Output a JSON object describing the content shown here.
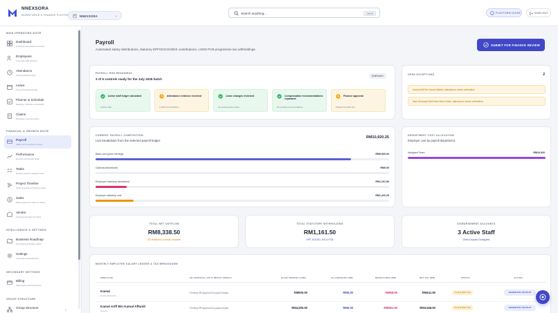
{
  "header": {
    "brand_name": "NNEXSORA",
    "brand_sub": "WORKFORCE & FINANCE PLATFORM",
    "org_label": "NNEXSORA",
    "search_placeholder": "Search anything...",
    "search_shortcut": "Ctrl+K",
    "guide_label": "PLATFORM GUIDE",
    "signout_label": "SIGN OUT"
  },
  "sidebar": {
    "sections": [
      {
        "title": "MAIN OPERATING SUITE"
      },
      {
        "title": "FINANCIAL & GROWTH SUITE"
      },
      {
        "title": "INTELLIGENCE & SETTINGS"
      },
      {
        "title": "SECONDARY SETTINGS"
      },
      {
        "title": "GROUP STRUCTURE"
      }
    ],
    "items": [
      {
        "label": "Dashboard",
        "sub": "Company performance overview",
        "icon": "grid-icon"
      },
      {
        "label": "Employees",
        "sub": "Corporate staff directory",
        "icon": "users-icon"
      },
      {
        "label": "Attendance",
        "sub": "Verified geofence logs",
        "icon": "clock-icon"
      },
      {
        "label": "Leave",
        "sub": "Time-off scheduling logs",
        "icon": "calendar-icon"
      },
      {
        "label": "Planner & Schedule",
        "sub": "Meetings, activities & checklists",
        "icon": "planner-icon"
      },
      {
        "label": "Claims",
        "sub": "Employee expense claims",
        "icon": "receipt-icon"
      },
      {
        "label": "Payroll",
        "sub": "Salary and compliance engine",
        "icon": "payroll-icon"
      },
      {
        "label": "Performance",
        "sub": "Reviews and growth goals",
        "icon": "chart-icon"
      },
      {
        "label": "Tasks",
        "sub": "Monitor issued & assigned work",
        "icon": "tasks-icon"
      },
      {
        "label": "Project Timeline",
        "sub": "Gantt progress and delivery plans",
        "icon": "timeline-icon"
      },
      {
        "label": "Sales",
        "sub": "Sales leads and customer values",
        "icon": "sales-icon"
      },
      {
        "label": "Vendor",
        "sub": "Invoicing and payment flows",
        "icon": "vendor-icon"
      },
      {
        "label": "Business Roadmap",
        "sub": "Forecasting & targets setting",
        "icon": "roadmap-icon"
      },
      {
        "label": "Settings",
        "sub": "Corporate threshold limits",
        "icon": "gear-icon"
      },
      {
        "label": "Billing",
        "sub": "Subscription pricing licenses",
        "icon": "billing-icon"
      },
      {
        "label": "Group Structure",
        "sub": "",
        "icon": "structure-icon"
      }
    ]
  },
  "hero": {
    "title": "Payroll",
    "subtitle": "Automated salary distributions, statutory EPF/SOCSO/EIS contributions, LHDN PCB progressive tax withholdings.",
    "submit_label": "SUBMIT FOR FINANCE REVIEW"
  },
  "readiness": {
    "label": "PAYROLL RUN READINESS",
    "headline": "3 of 5 controls ready for the July 2026 batch",
    "badge": "Draft batch",
    "controls": [
      {
        "title": "Active staff ledger calculated",
        "sub": "3 active staff",
        "state": "ok"
      },
      {
        "title": "Attendance evidence received",
        "sub": "2 staff need verification",
        "state": "warn"
      },
      {
        "title": "Leave changes reviewed",
        "sub": "No pending leave review",
        "state": "ok"
      },
      {
        "title": "Compensation recommendations separated",
        "sub": "No pending recommendations",
        "state": "ok"
      },
      {
        "title": "Finance approval",
        "sub": "Prepare the batch first",
        "state": "warn"
      }
    ]
  },
  "exceptions": {
    "label": "OPEN EXCEPTIONS",
    "count": "2",
    "items": [
      "Kamal Ariff Bin Kamal Affandi: attendance needs verification",
      "Wan Ghazaani Binti Wan Mohd Sabri: attendance needs verification"
    ]
  },
  "composition": {
    "label": "CURRENT PAYROLL COMPOSITION",
    "subtitle": "Live breakdown from the selected payroll ledger.",
    "total": "RM10,920.25",
    "rows": [
      {
        "label": "Basic and gross earnings",
        "value": "RM9,500.00",
        "fraction": 0.87,
        "color": "#5a5fd6"
      },
      {
        "label": "Optional allowances",
        "value": "RM0.00",
        "fraction": 0,
        "color": "#5a5fd6"
      },
      {
        "label": "Employee statutory deductions",
        "value": "RM1,161.50",
        "fraction": 0.106,
        "color": "#e0306a"
      },
      {
        "label": "Employer statutory cost",
        "value": "RM1,420.25",
        "fraction": 0.13,
        "color": "#f09213"
      }
    ]
  },
  "dept": {
    "label": "DEPARTMENT COST ALLOCATION",
    "subtitle": "Employer cost by payroll department.",
    "row_label": "Assigned Team",
    "row_value": "RM10,920",
    "fraction": 1
  },
  "stats": [
    {
      "label": "TOTAL NET OUTFLOW",
      "value": "RM8,338.50",
      "sub": "3/3 readiness controls complete",
      "sub_color": "#e08a00"
    },
    {
      "label": "TOTAL STATUTORY WITHHOLDING",
      "value": "RM1,161.50",
      "sub": "EPF, SOCSO, EIS & PCB",
      "sub_color": "#3f4cc4"
    },
    {
      "label": "DISBURSEMENT ACCOUNTS",
      "value": "3 Active Staff",
      "sub": "Direct Deposit Configured",
      "sub_color": "#3f4cc4"
    }
  ],
  "ledger": {
    "label": "MONTHLY EMPLOYEE SALARY LEDGER & TAX BREAKDOWN",
    "headers": [
      "EMPLOYEE",
      "HR APPROVAL KPI & IMPACT IMPACT",
      "BASIC MONTHLY (RM)",
      "ALLOWANCES (RM)",
      "DEDUCTIONS (RM)",
      "NET PAY (RM)",
      "STATUS",
      "ACTION"
    ],
    "rows": [
      {
        "name": "Kamal",
        "sub": "Human Resource",
        "impact": "Pending HR Approval No payroll impact",
        "basic": "RM500.00",
        "allow": "RM0.00",
        "deduct": "-RM58.50",
        "net": "RM441.50",
        "status": "Pending Batch Run",
        "action": "GENERATE PAYSLIP"
      },
      {
        "name": "Kamal Ariff Bin Kamal Affandi",
        "sub": "Human",
        "impact": "Pending HR Approval No payroll impact",
        "basic": "RM4,500.00",
        "allow": "RM0.00",
        "deduct": "-RM551.50",
        "net": "RM3,948.50",
        "status": "Pending Batch Run",
        "action": "GENERATE PAYSLIP"
      }
    ]
  }
}
